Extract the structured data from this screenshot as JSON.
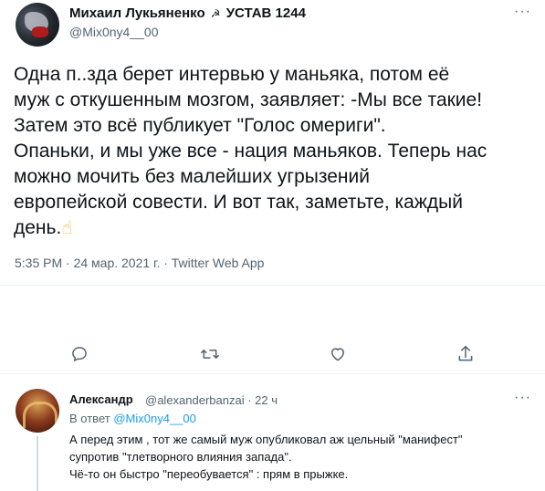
{
  "tweet": {
    "author_name": "Михаил Лукьяненко",
    "author_badge": "☭",
    "author_suffix": "УСТАВ 1244",
    "author_handle": "@Mix0ny4__00",
    "text": "Одна п..зда берет интервью у маньяка, потом её\nмуж с откушенным мозгом, заявляет: -Мы все такие!\nЗатем это всё публикует \"Голос омериги\".\nОпаньки, и мы уже все - нация маньяков. Теперь нас\nможно мочить без малейших угрызений\nевропейской совести. И вот так, заметьте, каждый\nдень.",
    "emoji": "☝",
    "timestamp": "5:35 PM · 24 мар. 2021 г. · Twitter Web App",
    "actions": {
      "reply": "reply-icon",
      "retweet": "retweet-icon",
      "like": "heart-icon",
      "share": "share-icon"
    }
  },
  "reply": {
    "author_name": "Александр",
    "author_handle": "@alexanderbanzai · 22 ч",
    "reply_to_prefix": "В ответ",
    "reply_to_handle": "@Mix0ny4__00",
    "text": "А перед этим , тот же самый муж опубликовал аж цельный \"манифест\"\nсупротив \"тлетворного влияния запада\".\nЧё-то он быстро \"переобувается\" : прям в прыжке."
  },
  "more_label": "···",
  "colors": {
    "accent": "#1d9bf0",
    "secondary_text": "#536471",
    "divider": "#eff3f4"
  }
}
